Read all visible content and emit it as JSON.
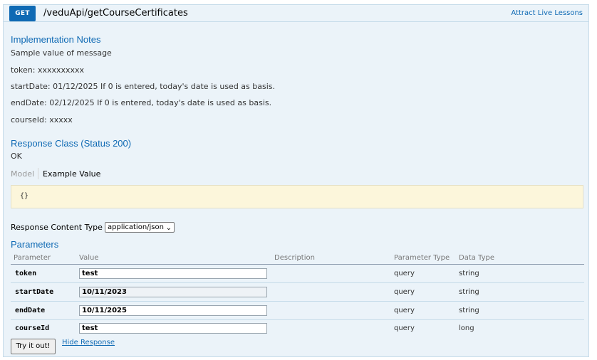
{
  "heading": {
    "method": "GET",
    "path": "/veduApi/getCourseCertificates",
    "right_link": "Attract Live Lessons"
  },
  "implementation": {
    "title": "Implementation Notes",
    "lines": [
      "Sample value of message",
      "token: xxxxxxxxxx",
      "startDate: 01/12/2025 If 0 is entered, today's date is used as basis.",
      "endDate: 02/12/2025 If 0 is entered, today's date is used as basis.",
      "courseId: xxxxx"
    ]
  },
  "response_class": {
    "title": "Response Class (Status 200)",
    "status_text": "OK",
    "tabs": [
      "Model",
      "Example Value"
    ],
    "example_value": "{}"
  },
  "response_content_type": {
    "label": "Response Content Type",
    "selected": "application/json"
  },
  "parameters": {
    "title": "Parameters",
    "columns": [
      "Parameter",
      "Value",
      "Description",
      "Parameter Type",
      "Data Type"
    ],
    "rows": [
      {
        "name": "token",
        "value": "test",
        "description": "",
        "param_type": "query",
        "data_type": "string"
      },
      {
        "name": "startDate",
        "value": "10/11/2023",
        "description": "",
        "param_type": "query",
        "data_type": "string"
      },
      {
        "name": "endDate",
        "value": "10/11/2025",
        "description": "",
        "param_type": "query",
        "data_type": "string"
      },
      {
        "name": "courseId",
        "value": "test",
        "description": "",
        "param_type": "query",
        "data_type": "long"
      }
    ]
  },
  "actions": {
    "try_label": "Try it out!",
    "hide_label": "Hide Response"
  },
  "colors": {
    "accent": "#0f6ab4",
    "panel_bg": "#ebf3f9",
    "snippet_bg": "#fcf6db"
  }
}
